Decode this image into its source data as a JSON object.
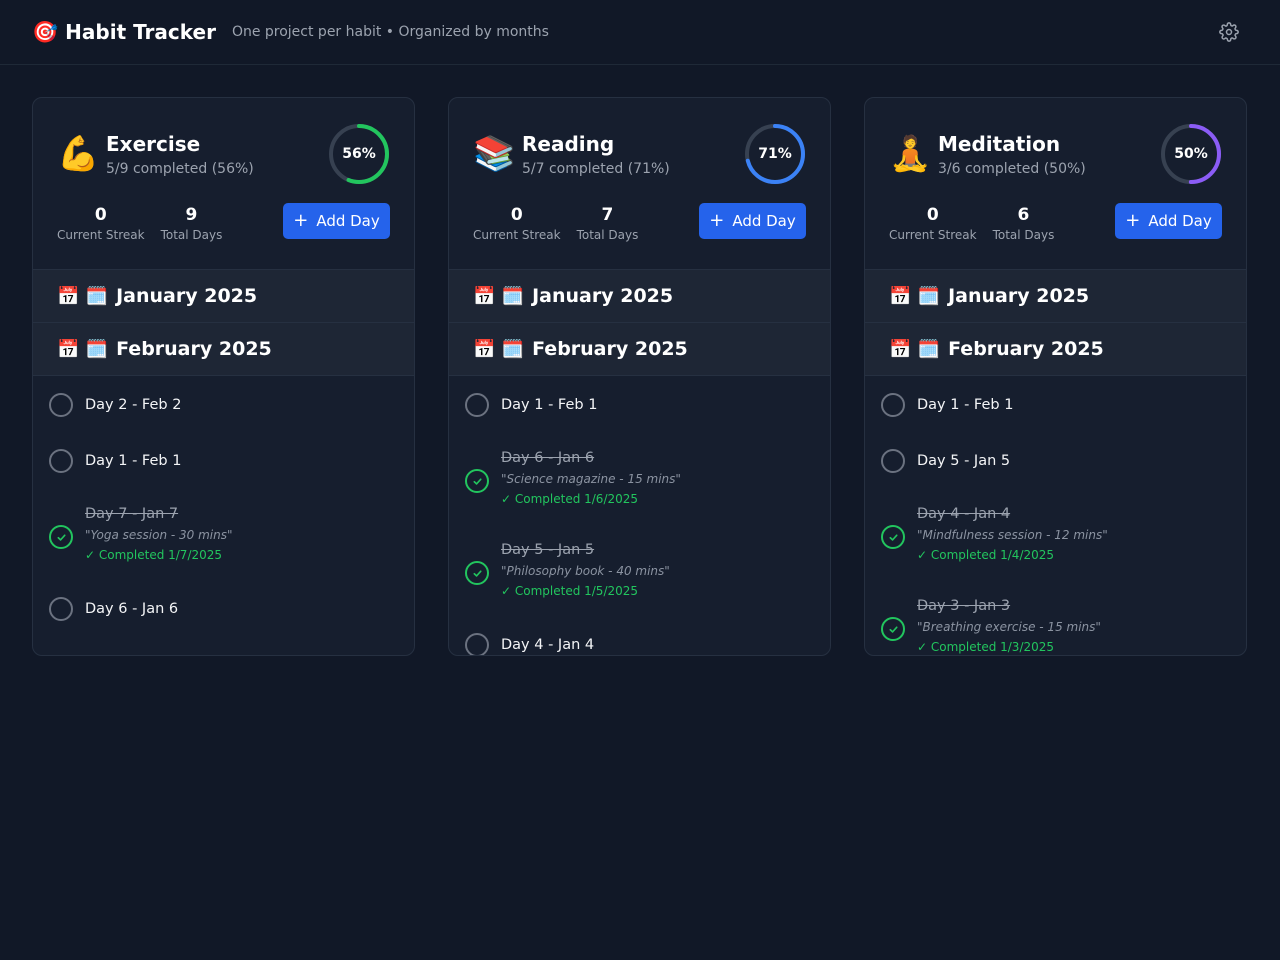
{
  "header": {
    "icon": "🎯",
    "title": "Habit Tracker",
    "subtitle": "One project per habit • Organized by months",
    "settings_icon": "gear-icon"
  },
  "colors": {
    "background": "#111827",
    "card": "#161e2e",
    "accent_blue": "#2563eb",
    "success_green": "#22c55e",
    "ring_exercise": "#22c55e",
    "ring_reading": "#3b82f6",
    "ring_meditation": "#8b5cf6"
  },
  "habits": [
    {
      "emoji": "💪",
      "name": "Exercise",
      "progress_text": "5/9 completed (56%)",
      "percent_label": "56%",
      "percent": 56,
      "ring_color": "#22c55e",
      "streak_value": "0",
      "streak_label": "Current Streak",
      "total_value": "9",
      "total_label": "Total Days",
      "add_label": "Add Day",
      "months": [
        {
          "icons": "📅 🗓️",
          "label": "January 2025"
        },
        {
          "icons": "📅 🗓️",
          "label": "February 2025"
        }
      ],
      "days": [
        {
          "title": "Day 2 - Feb 2",
          "done": false
        },
        {
          "title": "Day 1 - Feb 1",
          "done": false
        },
        {
          "title": "Day 7 - Jan 7",
          "done": true,
          "note": "\"Yoga session - 30 mins\"",
          "completed": "✓ Completed 1/7/2025"
        },
        {
          "title": "Day 6 - Jan 6",
          "done": false
        }
      ]
    },
    {
      "emoji": "📚",
      "name": "Reading",
      "progress_text": "5/7 completed (71%)",
      "percent_label": "71%",
      "percent": 71,
      "ring_color": "#3b82f6",
      "streak_value": "0",
      "streak_label": "Current Streak",
      "total_value": "7",
      "total_label": "Total Days",
      "add_label": "Add Day",
      "months": [
        {
          "icons": "📅 🗓️",
          "label": "January 2025"
        },
        {
          "icons": "📅 🗓️",
          "label": "February 2025"
        }
      ],
      "days": [
        {
          "title": "Day 1 - Feb 1",
          "done": false
        },
        {
          "title": "Day 6 - Jan 6",
          "done": true,
          "note": "\"Science magazine - 15 mins\"",
          "completed": "✓ Completed 1/6/2025"
        },
        {
          "title": "Day 5 - Jan 5",
          "done": true,
          "note": "\"Philosophy book - 40 mins\"",
          "completed": "✓ Completed 1/5/2025"
        },
        {
          "title": "Day 4 - Jan 4",
          "done": false
        }
      ]
    },
    {
      "emoji": "🧘",
      "name": "Meditation",
      "progress_text": "3/6 completed (50%)",
      "percent_label": "50%",
      "percent": 50,
      "ring_color": "#8b5cf6",
      "streak_value": "0",
      "streak_label": "Current Streak",
      "total_value": "6",
      "total_label": "Total Days",
      "add_label": "Add Day",
      "months": [
        {
          "icons": "📅 🗓️",
          "label": "January 2025"
        },
        {
          "icons": "📅 🗓️",
          "label": "February 2025"
        }
      ],
      "days": [
        {
          "title": "Day 1 - Feb 1",
          "done": false
        },
        {
          "title": "Day 5 - Jan 5",
          "done": false
        },
        {
          "title": "Day 4 - Jan 4",
          "done": true,
          "note": "\"Mindfulness session - 12 mins\"",
          "completed": "✓ Completed 1/4/2025"
        },
        {
          "title": "Day 3 - Jan 3",
          "done": true,
          "note": "\"Breathing exercise - 15 mins\"",
          "completed": "✓ Completed 1/3/2025"
        }
      ]
    }
  ]
}
